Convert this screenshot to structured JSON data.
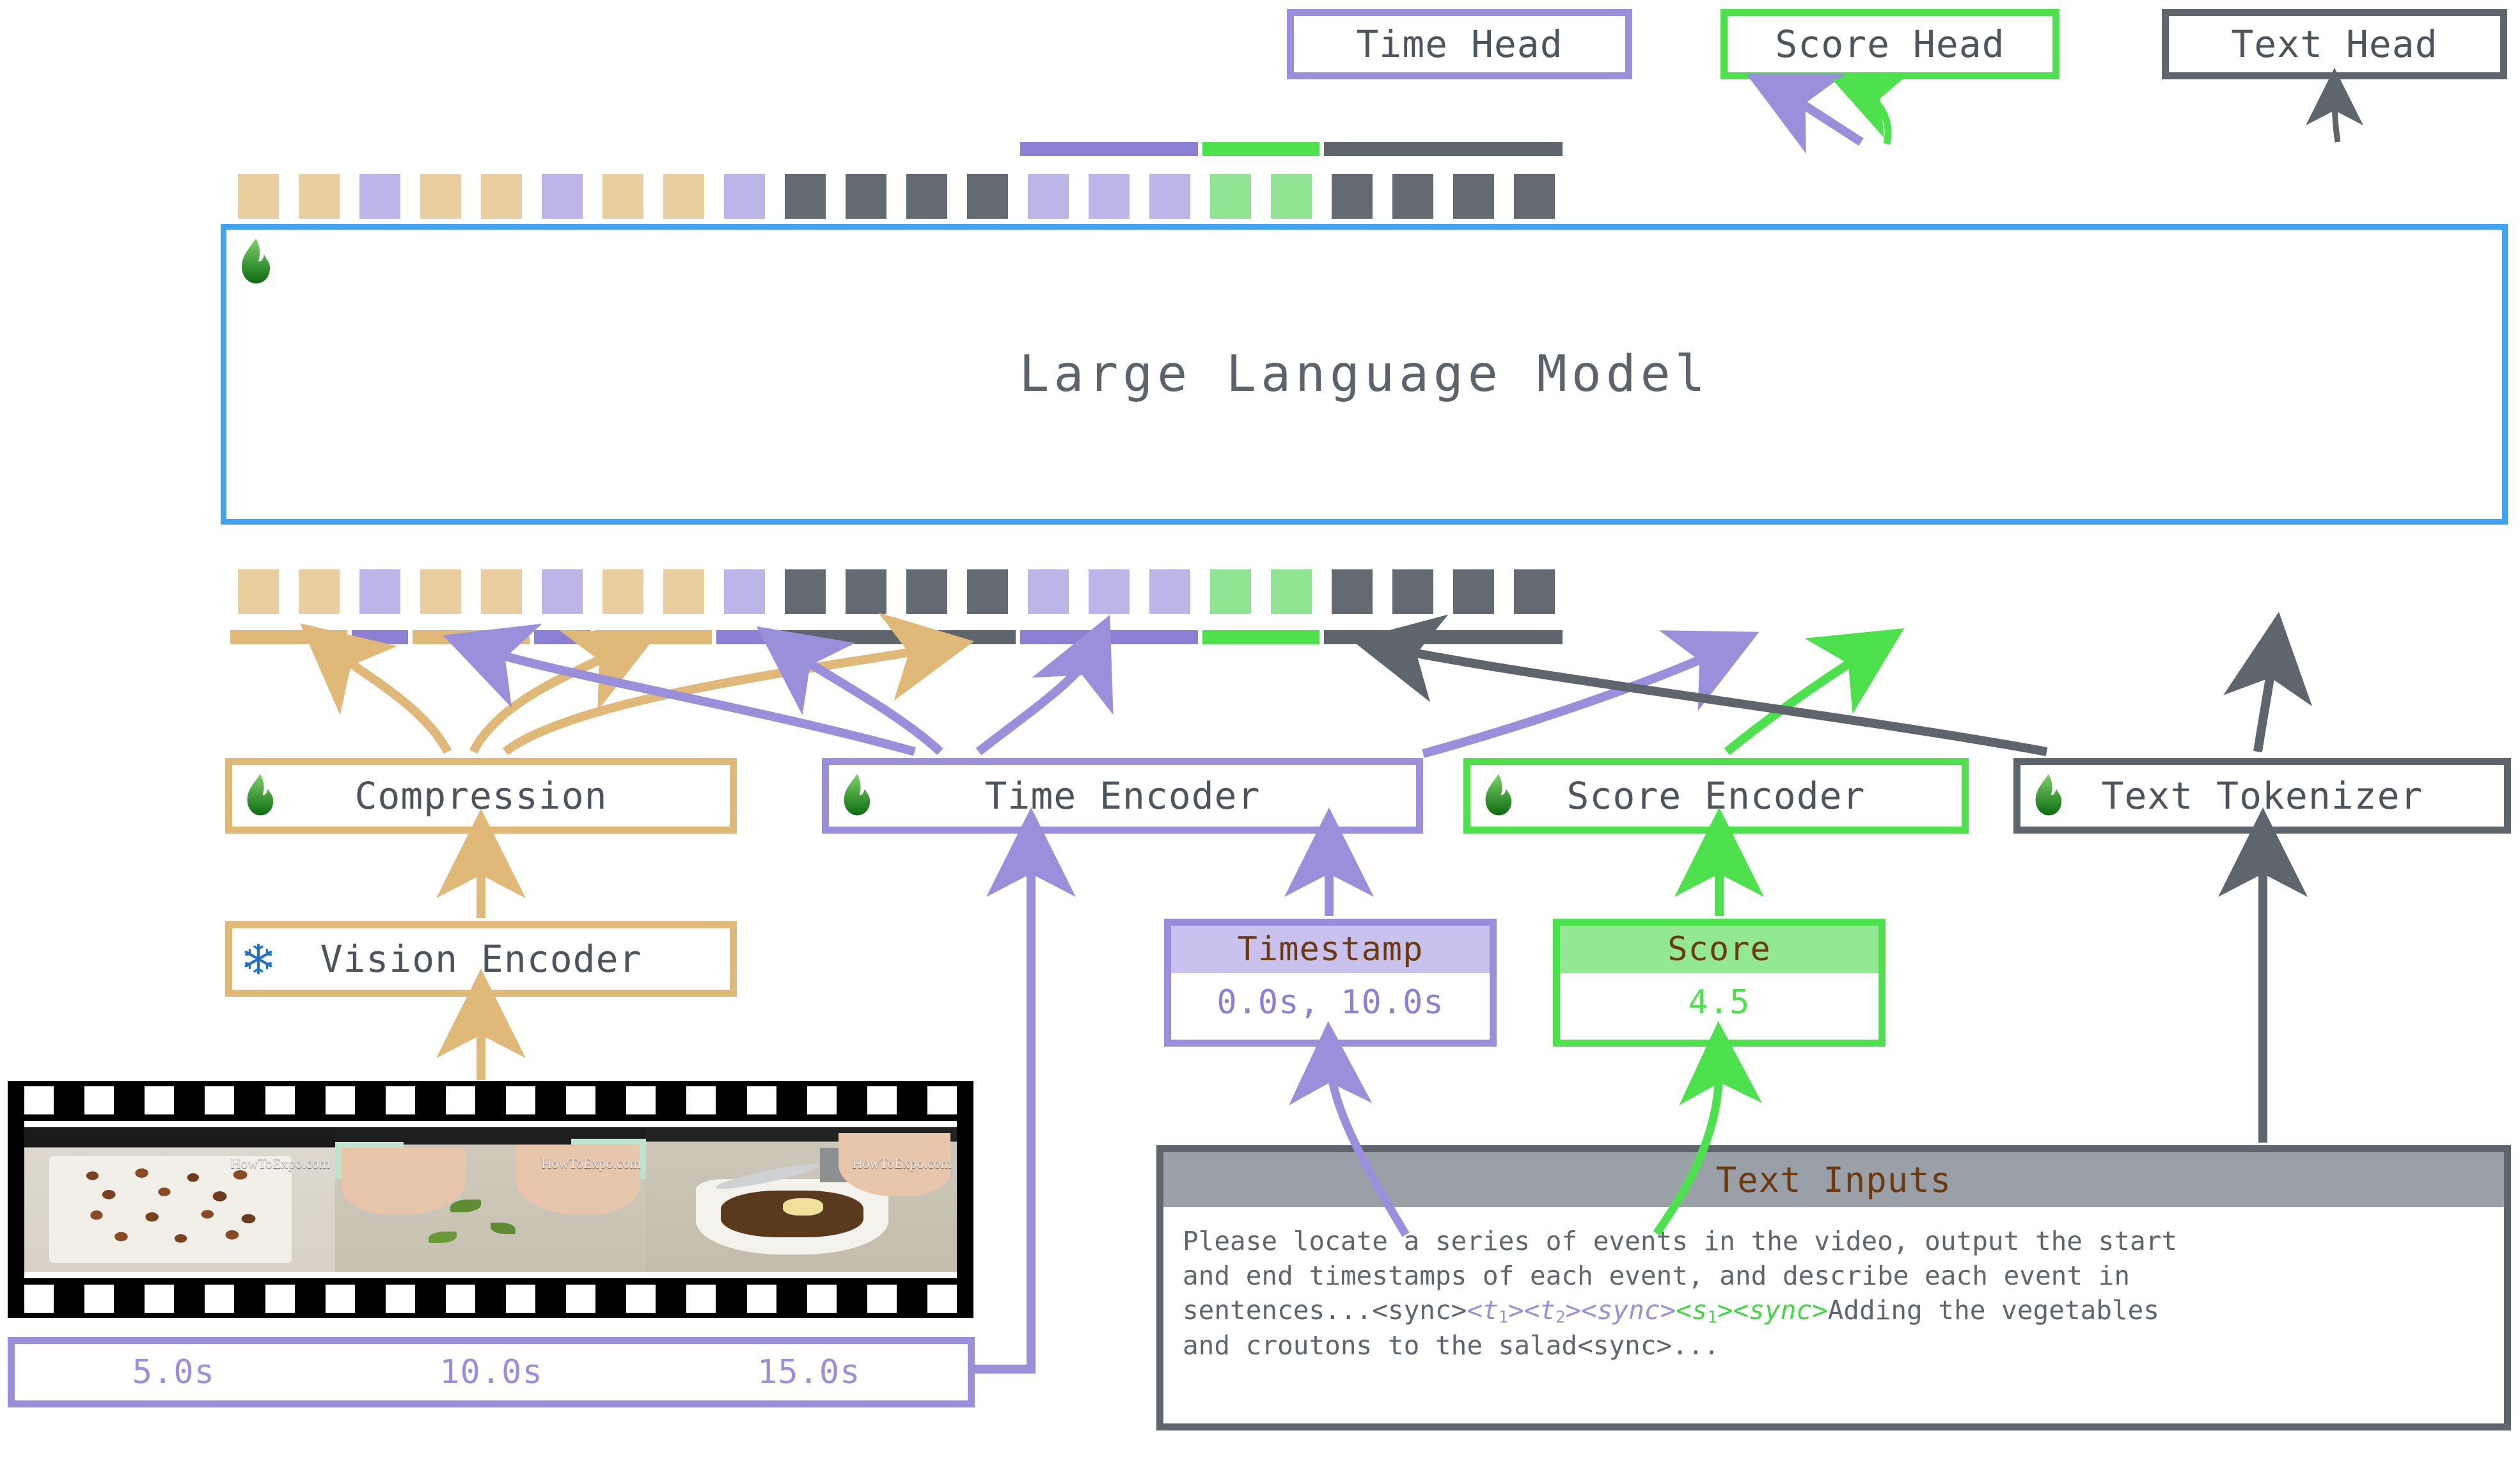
{
  "heads": [
    {
      "id": "time-head",
      "label": "Time Head",
      "color": "#9a8fdb"
    },
    {
      "id": "score-head",
      "label": "Score Head",
      "color": "#4de24d"
    },
    {
      "id": "text-head",
      "label": "Text Head",
      "color": "#5f656d"
    }
  ],
  "llm": {
    "label": "Large Language Model",
    "border_color": "#3fa4f6",
    "badge": "fire-icon"
  },
  "tokens": {
    "note": "token type sequence shared by the output (top) and input (bottom) embedding rows",
    "sequence": [
      "tan",
      "tan",
      "pur",
      "tan",
      "tan",
      "pur",
      "tan",
      "tan",
      "pur",
      "gry",
      "gry",
      "gry",
      "gry",
      "pur",
      "pur",
      "pur",
      "grn",
      "grn",
      "gry",
      "gry",
      "gry",
      "gry"
    ]
  },
  "output_bars": [
    {
      "type": "pur",
      "from": 13,
      "to": 15
    },
    {
      "type": "grn",
      "from": 16,
      "to": 17
    },
    {
      "type": "gry",
      "from": 18,
      "to": 21
    }
  ],
  "input_bars": [
    {
      "type": "tan",
      "from": 0,
      "to": 1
    },
    {
      "type": "pur",
      "from": 2,
      "to": 2
    },
    {
      "type": "tan",
      "from": 3,
      "to": 4
    },
    {
      "type": "pur",
      "from": 5,
      "to": 5
    },
    {
      "type": "tan",
      "from": 6,
      "to": 7
    },
    {
      "type": "pur",
      "from": 8,
      "to": 8
    },
    {
      "type": "gry",
      "from": 9,
      "to": 12
    },
    {
      "type": "pur",
      "from": 13,
      "to": 15
    },
    {
      "type": "grn",
      "from": 16,
      "to": 17
    },
    {
      "type": "gry",
      "from": 18,
      "to": 21
    }
  ],
  "modules": [
    {
      "id": "compression",
      "label": "Compression",
      "badge": "fire-icon",
      "color": "#e0b877"
    },
    {
      "id": "time-encoder",
      "label": "Time Encoder",
      "badge": "fire-icon",
      "color": "#9a8fdb"
    },
    {
      "id": "score-encoder",
      "label": "Score Encoder",
      "badge": "fire-icon",
      "color": "#4de24d"
    },
    {
      "id": "text-tokenizer",
      "label": "Text Tokenizer",
      "badge": "fire-icon",
      "color": "#5f656d"
    },
    {
      "id": "vision-encoder",
      "label": "Vision Encoder",
      "badge": "snowflake-icon",
      "color": "#e0b877"
    }
  ],
  "cards": [
    {
      "id": "timestamp-card",
      "title": "Timestamp",
      "value": "0.0s, 10.0s",
      "color": "#9a8fdb"
    },
    {
      "id": "score-card",
      "title": "Score",
      "value": "4.5",
      "color": "#4de24d"
    }
  ],
  "text_inputs": {
    "title": "Text Inputs",
    "line1": "Please locate a series of events in the video, output the start",
    "line2": "and end timestamps of each event, and describe each event in",
    "line3_a": "sentences...<sync>",
    "line3_t1": "<t",
    "line3_t1sub": "1",
    "line3_t1b": ">",
    "line3_t2": "<t",
    "line3_t2sub": "2",
    "line3_t2b": "><sync>",
    "line3_s1": "<s",
    "line3_s1sub": "1",
    "line3_s1b": "><sync>",
    "line3_b": "Adding the vegetables",
    "line4": "and croutons to the salad<sync>..."
  },
  "video": {
    "watermark": "HowToExpo.com",
    "frames": [
      "salad-croutons-frame",
      "chopping-herbs-frame",
      "mixing-bowl-frame"
    ]
  },
  "timeline": {
    "ticks": [
      "5.0s",
      "10.0s",
      "15.0s"
    ],
    "color": "#9a8fdb"
  },
  "palette": {
    "tan": "#ebcea0",
    "tan_bar": "#e0b877",
    "purple": "#bdb4e8",
    "purple_bar": "#8c80d4",
    "purple_border": "#9a8fdb",
    "gray": "#646a72",
    "gray_bar": "#5f656d",
    "green": "#92e495",
    "green_bar": "#4de24d",
    "blue": "#3fa4f6",
    "text": "#4e545c",
    "brown": "#6b3a10"
  }
}
